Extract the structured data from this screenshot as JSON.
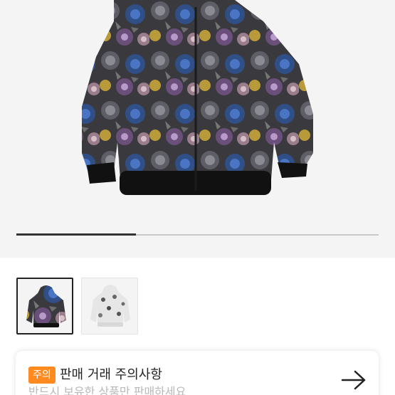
{
  "gallery": {
    "main_image": "floral-zip-hoodie-black",
    "slide_progress": 0.33,
    "thumbnails": [
      {
        "image": "floral-zip-hoodie-black",
        "selected": true
      },
      {
        "image": "floral-zip-hoodie-white",
        "selected": false
      }
    ]
  },
  "notice": {
    "badge": "주의",
    "title": "판매 거래 주의사항",
    "subtitle": "반드시 보유한 상품만 판매하세요",
    "icon": "arrow-right-icon"
  },
  "colors": {
    "badge_bg": "#ff8a1f",
    "progress_active": "#333333",
    "progress_track": "#c9c9c9"
  }
}
